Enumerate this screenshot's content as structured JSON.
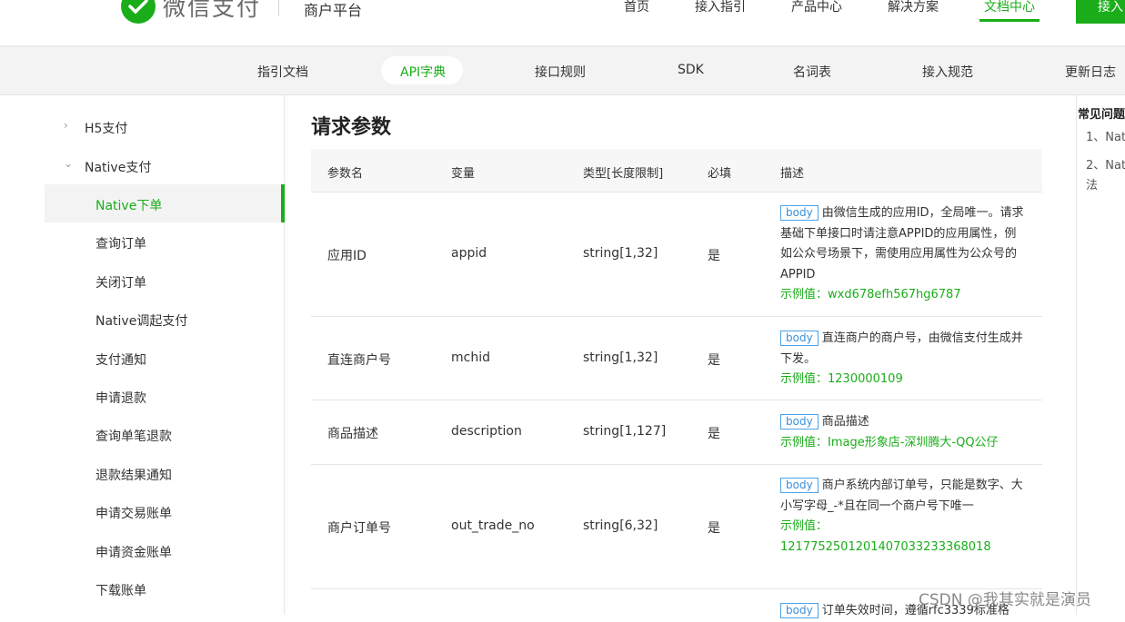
{
  "header": {
    "logo_text": "微信支付",
    "platform": "商户平台",
    "nav": [
      "首页",
      "接入指引",
      "产品中心",
      "解决方案",
      "文档中心"
    ],
    "active_nav": "文档中心",
    "login_button": "接入"
  },
  "subnav": {
    "items": [
      "指引文档",
      "API字典",
      "接口规则",
      "SDK",
      "名词表",
      "接入规范",
      "更新日志"
    ],
    "active": "API字典"
  },
  "sidebar": {
    "collapsed_group": "H5支付",
    "open_group": "Native支付",
    "items": [
      "Native下单",
      "查询订单",
      "关闭订单",
      "Native调起支付",
      "支付通知",
      "申请退款",
      "查询单笔退款",
      "退款结果通知",
      "申请交易账单",
      "申请资金账单",
      "下载账单"
    ],
    "active": "Native下单"
  },
  "main": {
    "section_title": "请求参数",
    "table": {
      "headers": [
        "参数名",
        "变量",
        "类型[长度限制]",
        "必填",
        "描述"
      ],
      "rows": [
        {
          "name": "应用ID",
          "var": "appid",
          "type": "string[1,32]",
          "required": "是",
          "tag": "body",
          "desc": "由微信生成的应用ID，全局唯一。请求基础下单接口时请注意APPID的应用属性，例如公众号场景下，需使用应用属性为公众号的APPID",
          "example": "示例值：wxd678efh567hg6787"
        },
        {
          "name": "直连商户号",
          "var": "mchid",
          "type": "string[1,32]",
          "required": "是",
          "tag": "body",
          "desc": "直连商户的商户号，由微信支付生成并下发。",
          "example": "示例值：1230000109"
        },
        {
          "name": "商品描述",
          "var": "description",
          "type": "string[1,127]",
          "required": "是",
          "tag": "body",
          "desc": "商品描述",
          "example": "示例值：Image形象店-深圳腾大-QQ公仔"
        },
        {
          "name": "商户订单号",
          "var": "out_trade_no",
          "type": "string[6,32]",
          "required": "是",
          "tag": "body",
          "desc": "商户系统内部订单号，只能是数字、大小写字母_-*且在同一个商户号下唯一",
          "example": "示例值：1217752501201407033233368018"
        },
        {
          "name": "",
          "var": "",
          "type": "",
          "required": "",
          "tag": "body",
          "desc": "订单失效时间，遵循rfc3339标准格",
          "example": ""
        }
      ]
    }
  },
  "right_panel": {
    "title": "常见问题",
    "items": [
      "1、Nat",
      "2、Nat",
      "法"
    ]
  },
  "watermark": "CSDN @我其实就是演员",
  "colors": {
    "accent": "#1aad19",
    "tag_border": "#4aa3e8"
  }
}
